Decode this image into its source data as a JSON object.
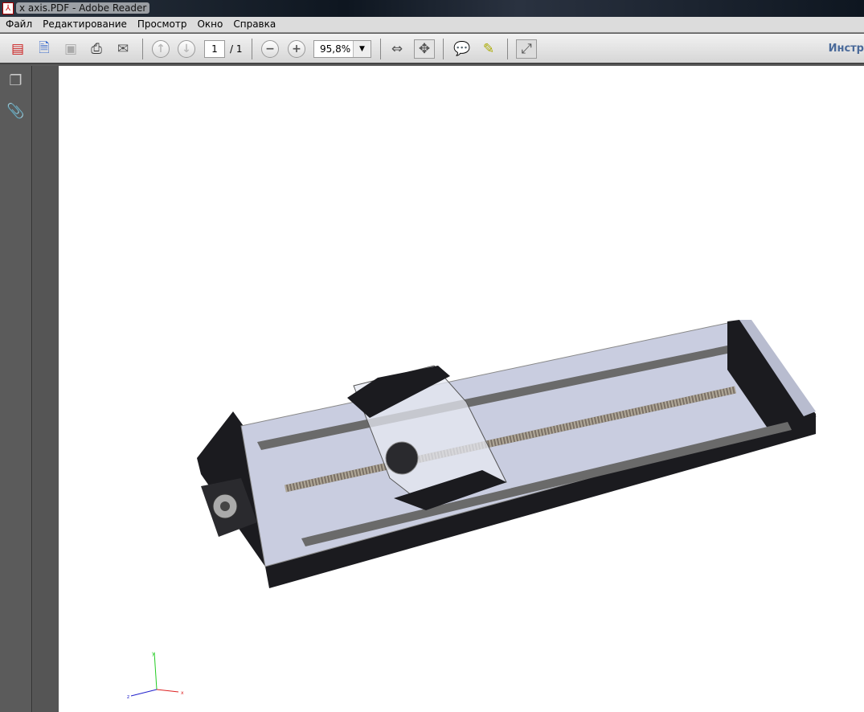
{
  "window": {
    "title": "x axis.PDF - Adobe Reader",
    "icon": "pdf-icon"
  },
  "menu": [
    "Файл",
    "Редактирование",
    "Просмотр",
    "Окно",
    "Справка"
  ],
  "toolbar": {
    "page_current": "1",
    "page_total": "/ 1",
    "zoom": "95,8%",
    "tools_label": "Инстр"
  },
  "axes": {
    "x": "x",
    "y": "y",
    "z": "z"
  },
  "colors": {
    "accent": "#4a6a9a",
    "page": "#ffffff",
    "body_plate": "#c9cde0",
    "body_dark": "#1b1b1f"
  }
}
